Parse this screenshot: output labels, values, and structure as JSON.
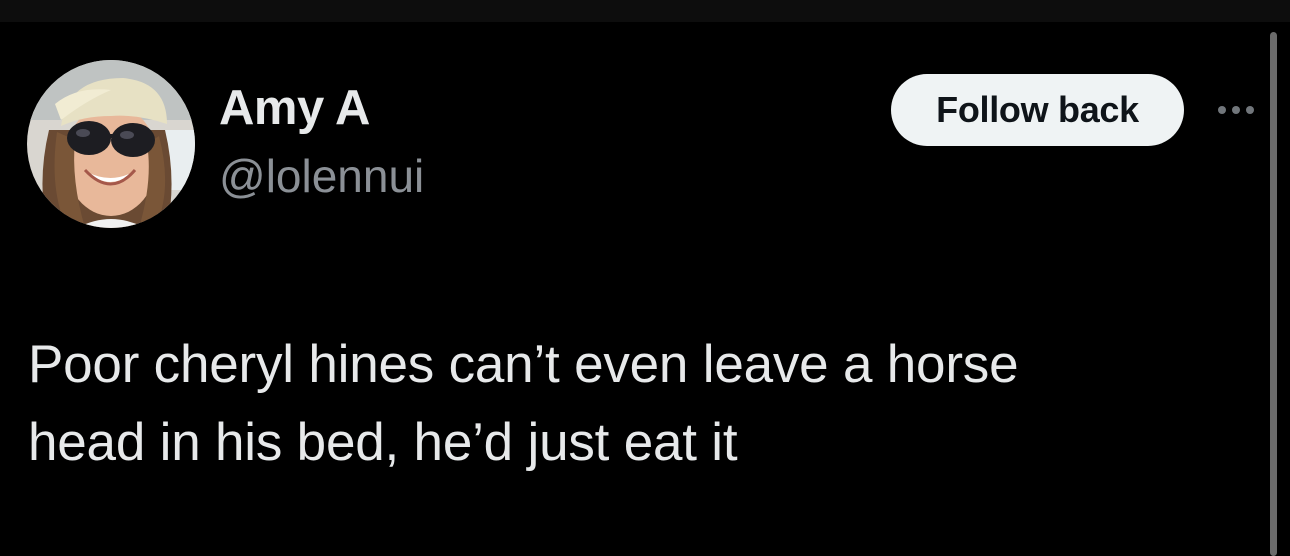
{
  "tweet": {
    "author": {
      "display_name": "Amy A",
      "handle": "@lolennui",
      "avatar_icon": "profile-photo"
    },
    "follow_button_label": "Follow back",
    "more_icon": "more-horizontal-icon",
    "text": "Poor cheryl hines can’t even leave a horse\nhead in his bed, he’d just eat it"
  },
  "colors": {
    "background": "#000000",
    "text_primary": "#e7e9ea",
    "text_secondary": "#8b9096",
    "button_bg": "#eff3f4",
    "button_text": "#0f1419"
  }
}
